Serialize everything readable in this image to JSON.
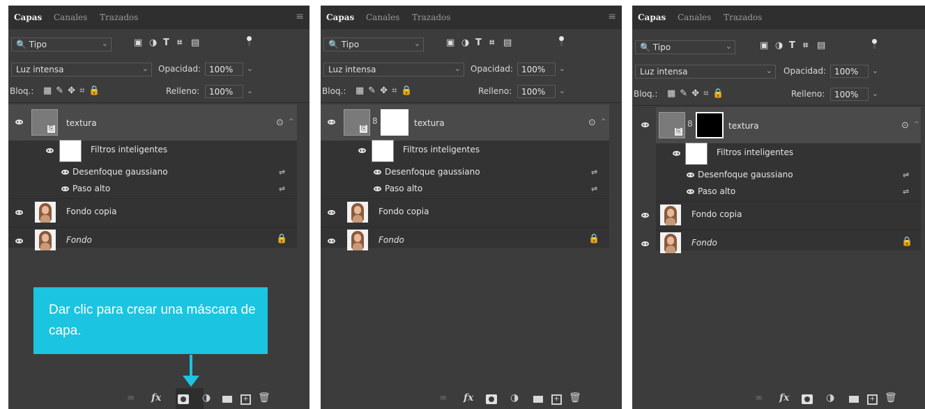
{
  "panels": [
    {
      "tabs": [
        "Capas",
        "Canales",
        "Trazados"
      ],
      "filter": "Tipo",
      "blend_mode": "Luz intensa",
      "opacity_label": "Opacidad:",
      "opacity": "100%",
      "lock_label": "Bloq.:",
      "fill_label": "Relleno:",
      "fill": "100%",
      "layers": {
        "textura": "textura",
        "smart_filters": "Filtros inteligentes",
        "filter1": "Desenfoque gaussiano",
        "filter2": "Paso alto",
        "copy": "Fondo copia",
        "background": "Fondo"
      },
      "mask": "none"
    },
    {
      "tabs": [
        "Capas",
        "Canales",
        "Trazados"
      ],
      "filter": "Tipo",
      "blend_mode": "Luz intensa",
      "opacity_label": "Opacidad:",
      "opacity": "100%",
      "lock_label": "Bloq.:",
      "fill_label": "Relleno:",
      "fill": "100%",
      "layers": {
        "textura": "textura",
        "smart_filters": "Filtros inteligentes",
        "filter1": "Desenfoque gaussiano",
        "filter2": "Paso alto",
        "copy": "Fondo copia",
        "background": "Fondo"
      },
      "mask_color": "#ffffff"
    },
    {
      "tabs": [
        "Capas",
        "Canales",
        "Trazados"
      ],
      "filter": "Tipo",
      "blend_mode": "Luz intensa",
      "opacity_label": "Opacidad:",
      "opacity": "100%",
      "lock_label": "Bloq.:",
      "fill_label": "Relleno:",
      "fill": "100%",
      "layers": {
        "textura": "textura",
        "smart_filters": "Filtros inteligentes",
        "filter1": "Desenfoque gaussiano",
        "filter2": "Paso alto",
        "copy": "Fondo copia",
        "background": "Fondo"
      },
      "mask_color": "#000000"
    }
  ],
  "callout": {
    "text": "Dar clic para crear una máscara de capa.",
    "color": "#1bc4e0"
  },
  "icons": {
    "search": "search-icon",
    "link": "link-icon",
    "fx": "fx-icon",
    "add_mask": "add-mask-icon",
    "adjustment": "adjustment-icon",
    "group": "folder-icon",
    "new_layer": "new-layer-icon",
    "delete": "trash-icon"
  },
  "footer": {
    "fx_text": "fx"
  }
}
